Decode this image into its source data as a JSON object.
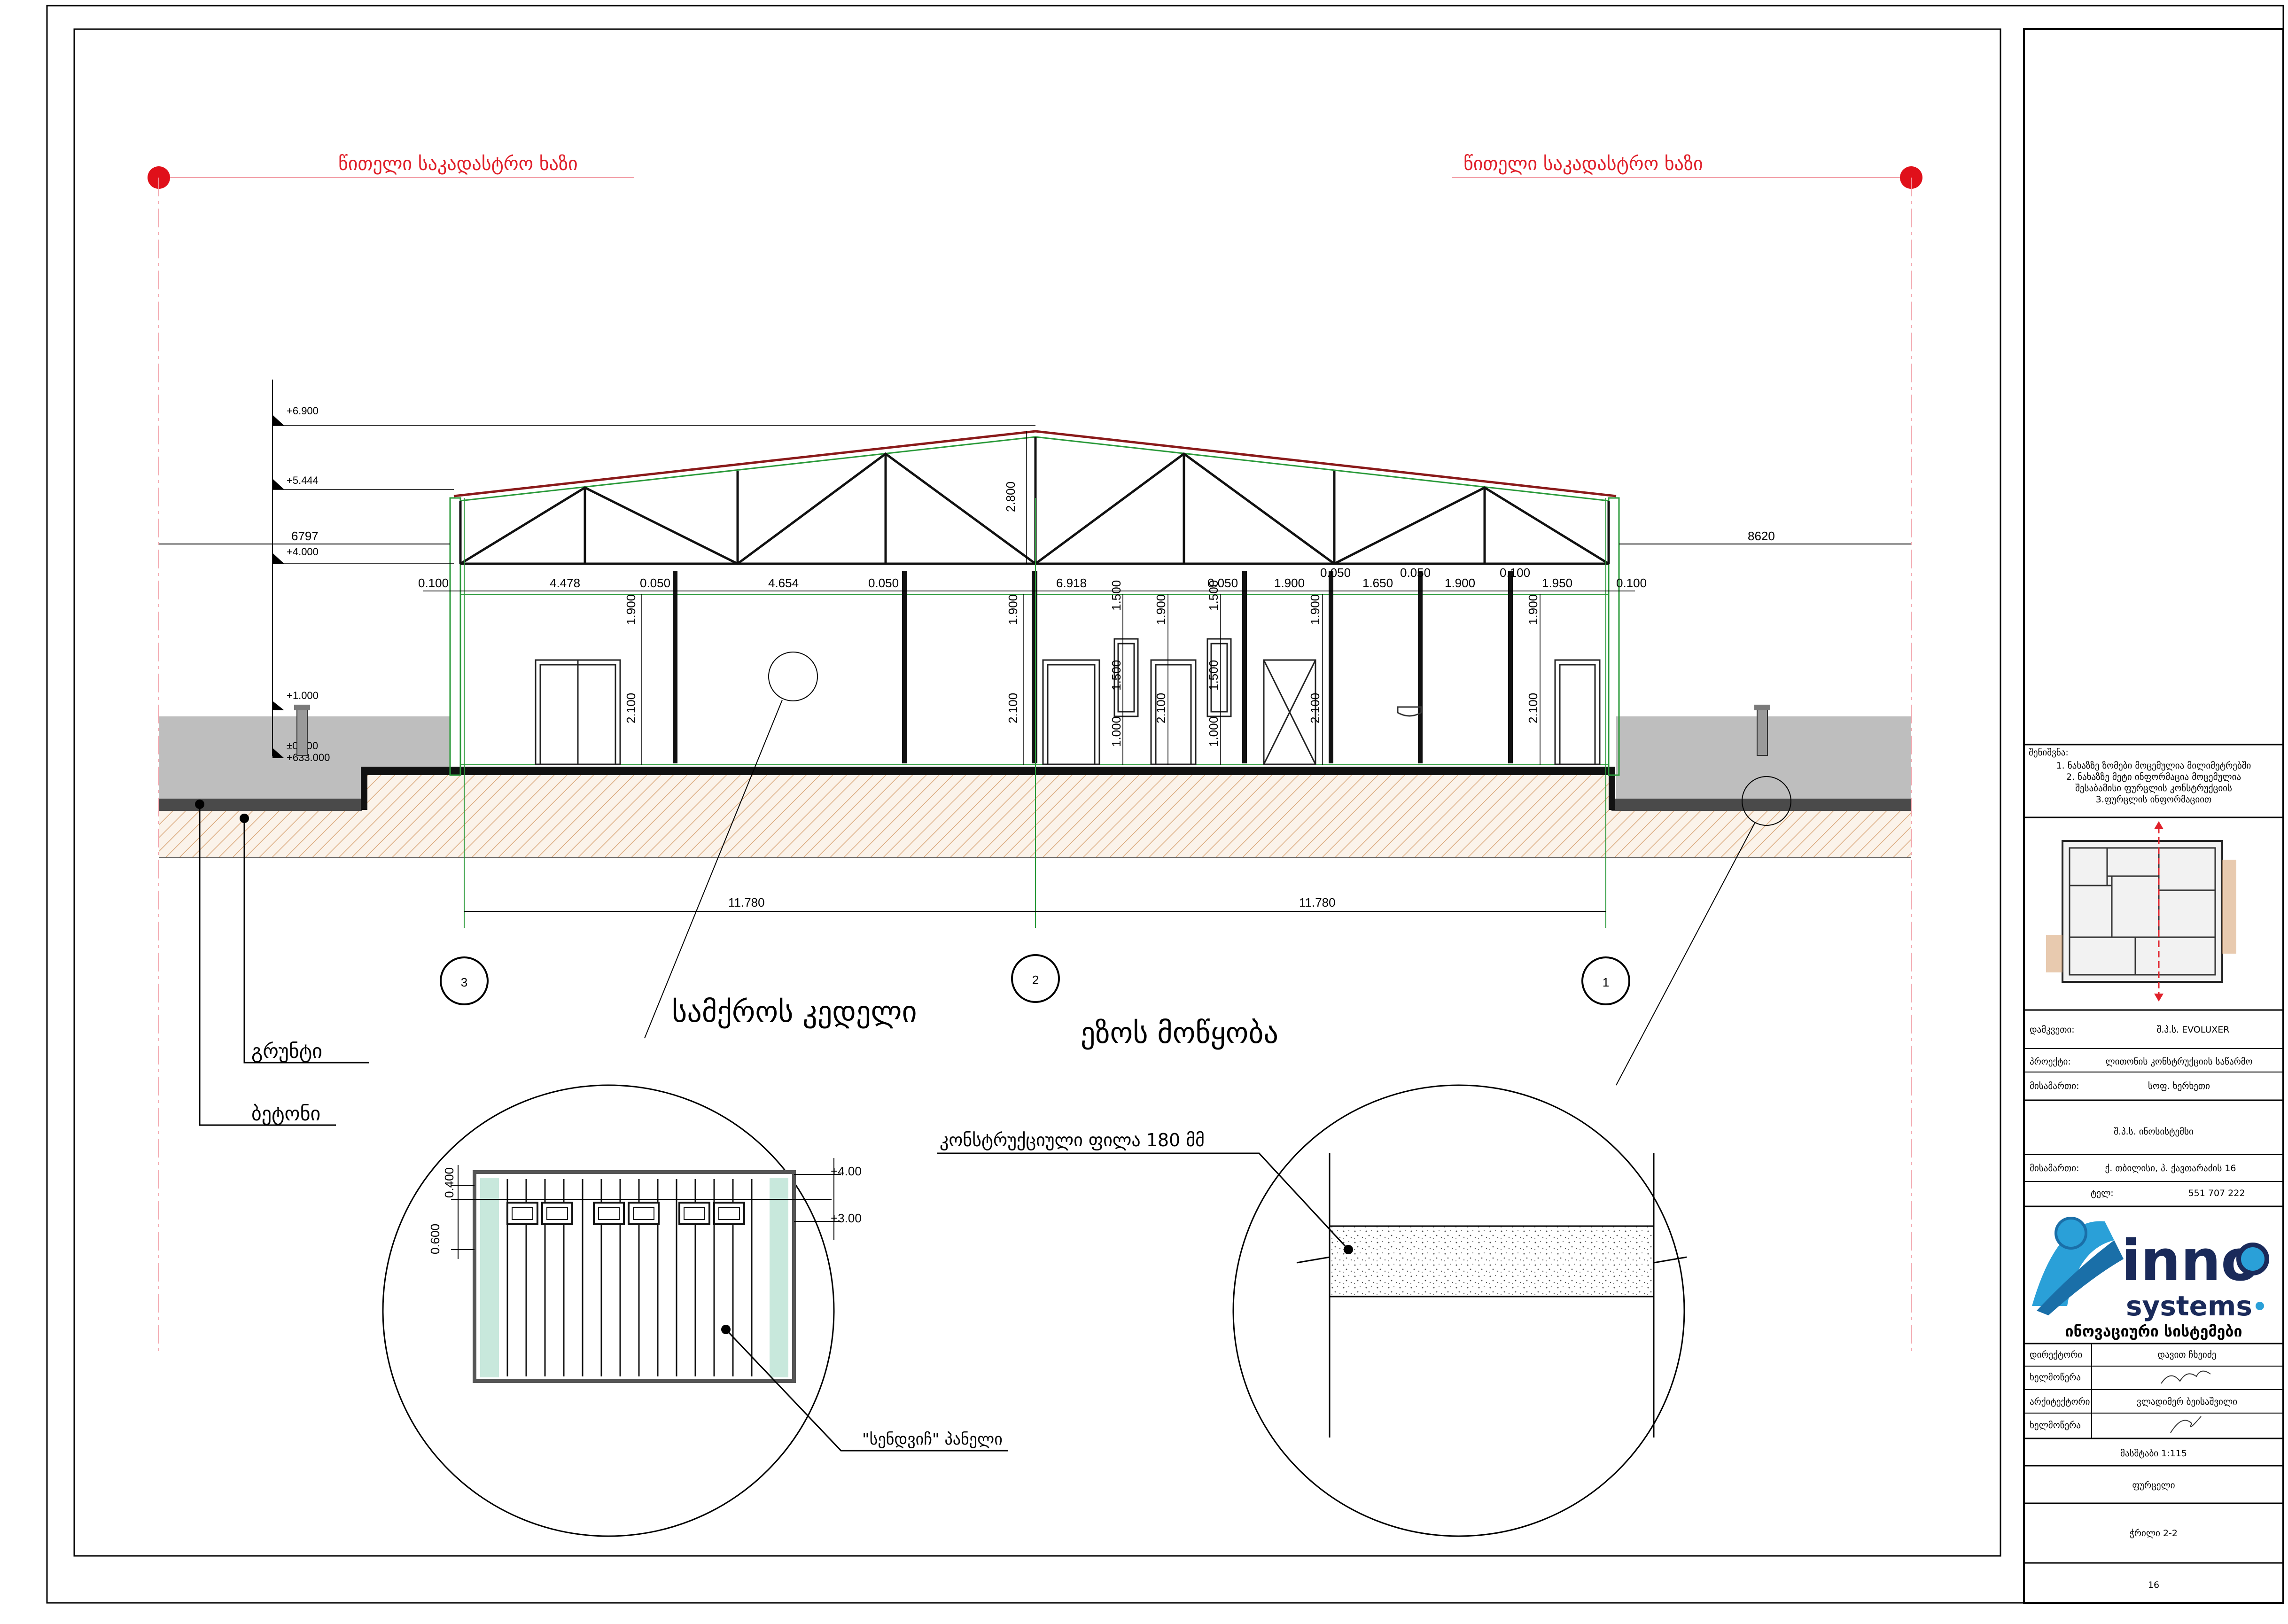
{
  "cadastral": {
    "left_label": "წითელი საკადასტრო ხაზი",
    "right_label": "წითელი საკადასტრო ხაზი"
  },
  "levels": [
    "+6.900",
    "+5.444",
    "+4.000",
    "+1.000",
    "±0.000",
    "+633.000"
  ],
  "dims_top": {
    "left_gap": "6797",
    "right_gap": "8620",
    "ridge_height": "2.800"
  },
  "dims_row": [
    "0.100",
    "4.478",
    "0.050",
    "4.654",
    "0.050",
    "6.918",
    "0.050",
    "1.900",
    "1.650",
    "0.050",
    "1.900",
    "0.100",
    "1.950",
    "0.100"
  ],
  "dims_row_upper": [
    "0.050",
    "0.050",
    "0.100"
  ],
  "dims_vertical": [
    "1.900",
    "2.100",
    "1.900",
    "2.100",
    "1.500",
    "1.500",
    "1.000",
    "1.900",
    "2.100",
    "1.500",
    "2.100",
    "1.000",
    "1.500",
    "1.000",
    "1.900",
    "2.100",
    "1.900",
    "2.100"
  ],
  "axis_dims": [
    "11.780",
    "11.780"
  ],
  "axes": [
    "3",
    "2",
    "1"
  ],
  "labels": {
    "wall_title": "სამქროს კედელი",
    "yard_title": "ეზოს მოწყობა",
    "ground": "გრუნტი",
    "concrete": "ბეტონი",
    "slab": "კონსტრუქციული ფილა 180 მმ",
    "sandwich": "\"სენდვიჩ\" პანელი",
    "detail_dims": [
      "0.400",
      "0.600",
      "+4.00",
      "+3.00"
    ]
  },
  "title_block": {
    "notes_label": "შენიშვნა:",
    "notes": [
      "1. ნახაზზე ზომები მოცემულია მილიმეტრებში",
      "2. ნახაზზე მეტი ინფორმაცია მოცემულია",
      "შესაბამისი ფურცლის კონსტრუქციის",
      "3.ფურცლის ინფორმაციით"
    ],
    "rows": [
      {
        "label": "დამკვეთი:",
        "value": "შ.პ.ს. EVOLUXER"
      },
      {
        "label": "პროექტი:",
        "value": "ლითონის კონსტრუქციის საწარმო"
      },
      {
        "label": "მისამართი:",
        "value": "სოფ. ხერხეთი"
      }
    ],
    "company": "შ.პ.ს. ინოსისტემსი",
    "company_rows": [
      {
        "label": "მისამართი:",
        "value": "ქ. თბილისი, პ. ქავთარაძის 16"
      },
      {
        "label": "ტელ:",
        "value": "551 707 222"
      }
    ],
    "logo_main": "inno",
    "logo_sub": "systems",
    "logo_caption": "ინოვაციური სისტემები",
    "staff": [
      {
        "label": "დირექტორი",
        "value": "დავით ჩხეიძე"
      },
      {
        "label": "ხელმოწერა",
        "value": ""
      },
      {
        "label": "არქიტექტორი",
        "value": "ვლადიმერ ბეისაშვილი"
      },
      {
        "label": "ხელმოწერა",
        "value": ""
      }
    ],
    "scale": "მასშტაბი 1:115",
    "sheet_name_label": "ფურცელი",
    "sheet_name": "ჭრილი 2-2",
    "sheet_no": "16"
  }
}
